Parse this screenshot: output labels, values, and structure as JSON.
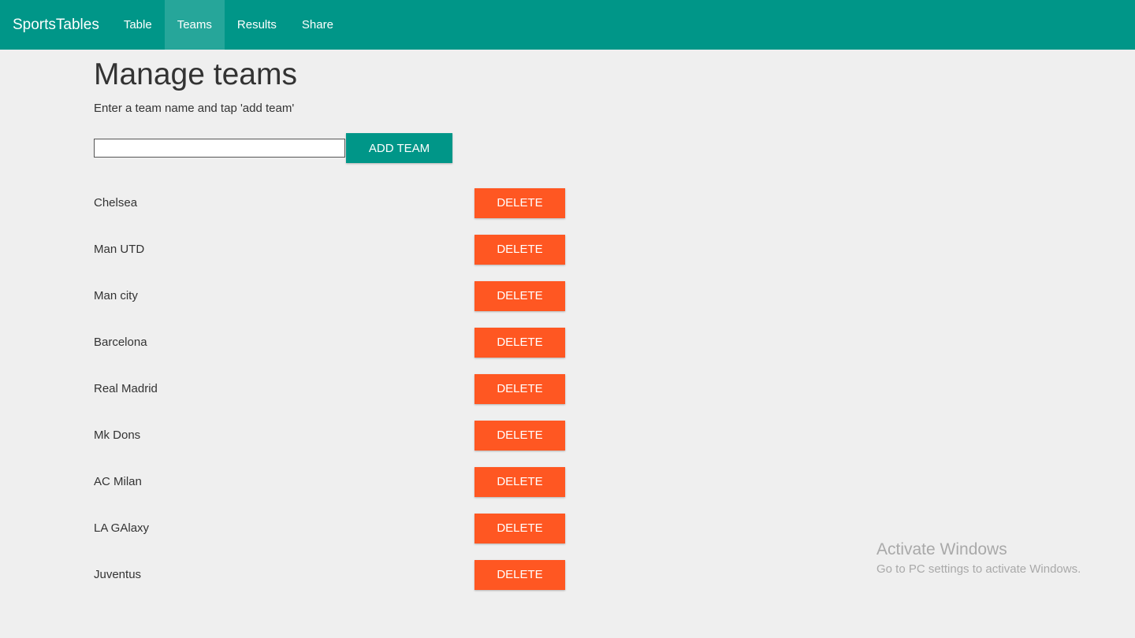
{
  "navbar": {
    "brand": "SportsTables",
    "items": [
      {
        "label": "Table",
        "active": false
      },
      {
        "label": "Teams",
        "active": true
      },
      {
        "label": "Results",
        "active": false
      },
      {
        "label": "Share",
        "active": false
      }
    ]
  },
  "main": {
    "title": "Manage teams",
    "instruction": "Enter a team name and tap 'add team'",
    "input_value": "",
    "add_label": "ADD TEAM",
    "delete_label": "DELETE",
    "teams": [
      "Chelsea",
      "Man UTD",
      "Man city",
      "Barcelona",
      "Real Madrid",
      "Mk Dons",
      "AC Milan",
      "LA GAlaxy",
      "Juventus"
    ]
  },
  "watermark": {
    "title": "Activate Windows",
    "subtitle": "Go to PC settings to activate Windows."
  },
  "colors": {
    "primary": "#009688",
    "active_tab": "#26a69a",
    "danger": "#ff5722",
    "background": "#efefef"
  }
}
